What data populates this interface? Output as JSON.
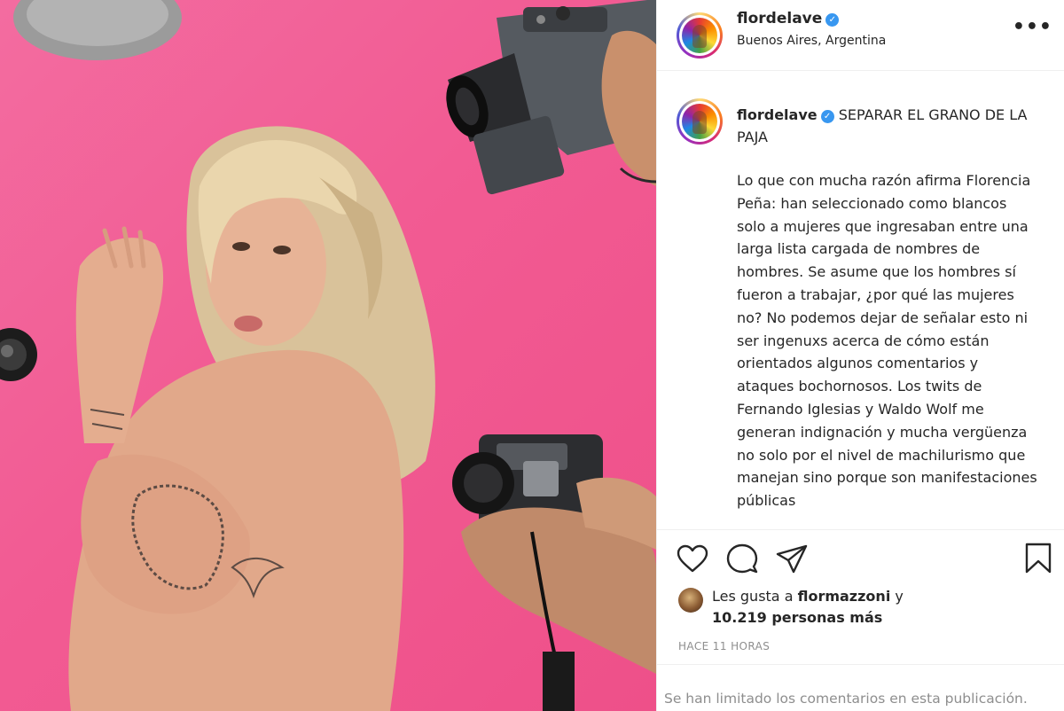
{
  "post": {
    "username": "flordelave",
    "location": "Buenos Aires, Argentina",
    "more_icon": "ellipsis-icon",
    "caption_title": "SEPARAR EL GRANO DE LA PAJA",
    "caption_body": "Lo que con mucha razón afirma Florencia Peña: han seleccionado como blancos solo a mujeres que ingresaban entre una larga lista cargada de nombres de hombres. Se asume que los hombres sí fueron a trabajar, ¿por qué las mujeres no? No podemos dejar de señalar esto ni ser ingenuxs acerca de cómo están orientados algunos comentarios y ataques bochornosos. Los twits de Fernando Iglesias y Waldo Wolf me generan indignación y mucha vergüenza no solo por el nivel de machilurismo que manejan sino porque son manifestaciones públicas",
    "likes_prefix": "Les gusta a",
    "liked_by": "flormazzoni",
    "likes_and": "y",
    "likes_count": "10.219 personas más",
    "timestamp": "HACE 11 HORAS",
    "comments_notice": "Se han limitado los comentarios en esta publicación.",
    "icons": {
      "like": "heart-icon",
      "comment": "comment-icon",
      "share": "paper-plane-icon",
      "save": "bookmark-icon",
      "verified": "verified-badge-icon"
    }
  },
  "colors": {
    "photo_background": "#f25b93",
    "verified": "#3897f0",
    "muted_text": "#8e8e8e",
    "text": "#262626"
  }
}
